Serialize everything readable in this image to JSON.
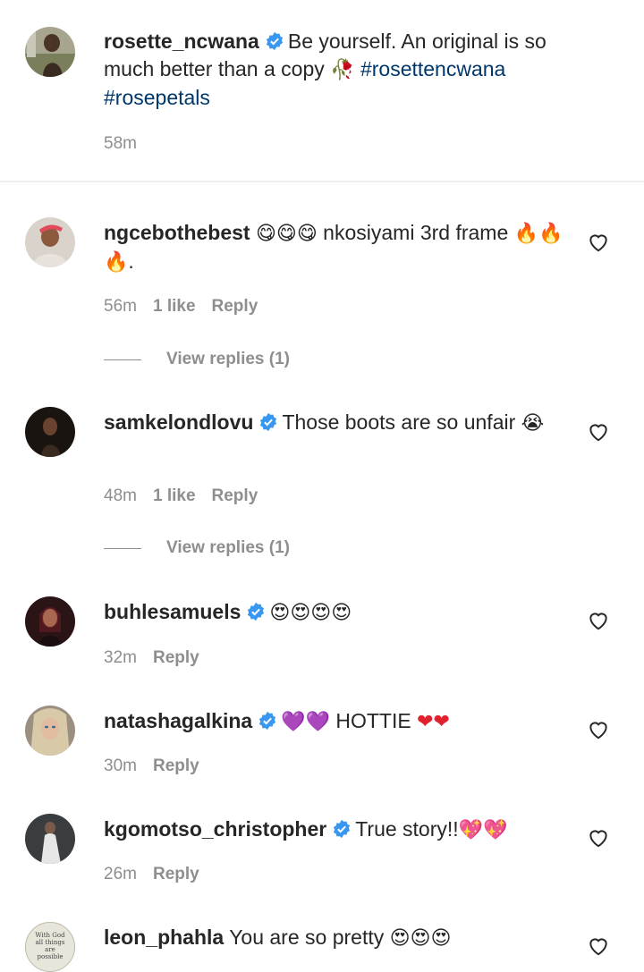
{
  "caption": {
    "username": "rosette_ncwana",
    "text": "Be yourself. An original is so much better than a copy",
    "emoji": "🥀",
    "hashtag1": "#rosettencwana",
    "hashtag2": "#rosepetals",
    "time": "58m"
  },
  "comments": [
    {
      "username": "ngcebothebest",
      "emoji1": "😋😋😋",
      "text": "nkosiyami 3rd frame",
      "emoji2": "🔥🔥🔥",
      "tail": ".",
      "time": "56m",
      "likes": "1 like",
      "reply": "Reply",
      "view_replies": "View replies (1)"
    },
    {
      "username": "samkelondlovu",
      "text": "Those boots are so unfair",
      "emoji": "😭",
      "time": "48m",
      "likes": "1 like",
      "reply": "Reply",
      "view_replies": "View replies (1)"
    },
    {
      "username": "buhlesamuels",
      "emoji": "😍😍😍😍",
      "time": "32m",
      "reply": "Reply"
    },
    {
      "username": "natashagalkina",
      "emoji1": "💜💜",
      "text": "HOTTIE",
      "emoji2": "❤❤",
      "time": "30m",
      "reply": "Reply"
    },
    {
      "username": "kgomotso_christopher",
      "text": "True story!!",
      "emoji": "💖💖",
      "time": "26m",
      "reply": "Reply"
    },
    {
      "username": "leon_phahla",
      "text": "You are so pretty",
      "emoji": "😍😍😍"
    }
  ],
  "leon_avatar_text": "With God all things are possible",
  "colors": {
    "text": "#262626",
    "meta": "#8e8e8e",
    "hashtag": "#00376b",
    "verified": "#3897f0"
  }
}
